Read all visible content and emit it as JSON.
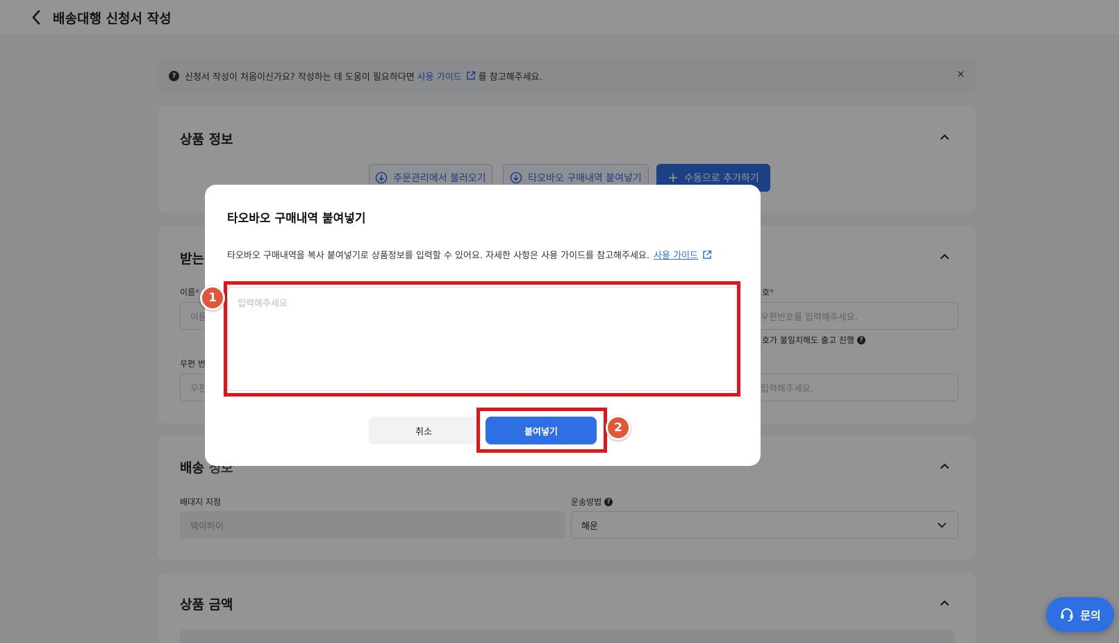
{
  "header": {
    "title": "배송대행 신청서 작성"
  },
  "notice": {
    "text_before": "신청서 작성이 처음이신가요? 작성하는 데 도움이 필요하다면",
    "link_label": "사용 가이드",
    "text_after": "를 참고해주세요.",
    "close_label": "×"
  },
  "product_info": {
    "title": "상품 정보",
    "buttons": {
      "import_orders": "주문관리에서 불러오기",
      "paste_taobao": "타오바오 구매내역 붙여넣기",
      "add_manual": "수동으로 추가하기"
    }
  },
  "recipient": {
    "title": "받는",
    "name_label": "이름",
    "name_placeholder": "이름",
    "postal_label": "우편 번",
    "postal_placeholder": "우편",
    "right_label": "호",
    "right_placeholder": "우편번호를 입력해주세요.",
    "mismatch_hint": "호가 불일치해도 출고 진행",
    "right_placeholder_2": "입력해주세요."
  },
  "shipping": {
    "title": "배송",
    "title_partial": "정보",
    "warehouse_label": "배대지 지점",
    "warehouse_value": "웨이하이",
    "method_label": "운송방법",
    "method_value": "해운"
  },
  "price": {
    "title": "상품 금액"
  },
  "modal": {
    "title": "타오바오 구매내역 붙여넣기",
    "description": "타오바오 구매내역을 복사 붙여넣기로 상품정보를 입력할 수 있어요. 자세한 사항은 사용 가이드를 참고해주세요.",
    "guide_link": "사용 가이드",
    "textarea_placeholder": "입력해주세요",
    "cancel_label": "취소",
    "paste_label": "붙여넣기"
  },
  "annotations": {
    "step1": "1",
    "step2": "2"
  },
  "floating": {
    "inquiry_label": "문의"
  },
  "colors": {
    "primary": "#2f6fe4",
    "highlight": "#e0161d",
    "badge": "#e0573a"
  }
}
